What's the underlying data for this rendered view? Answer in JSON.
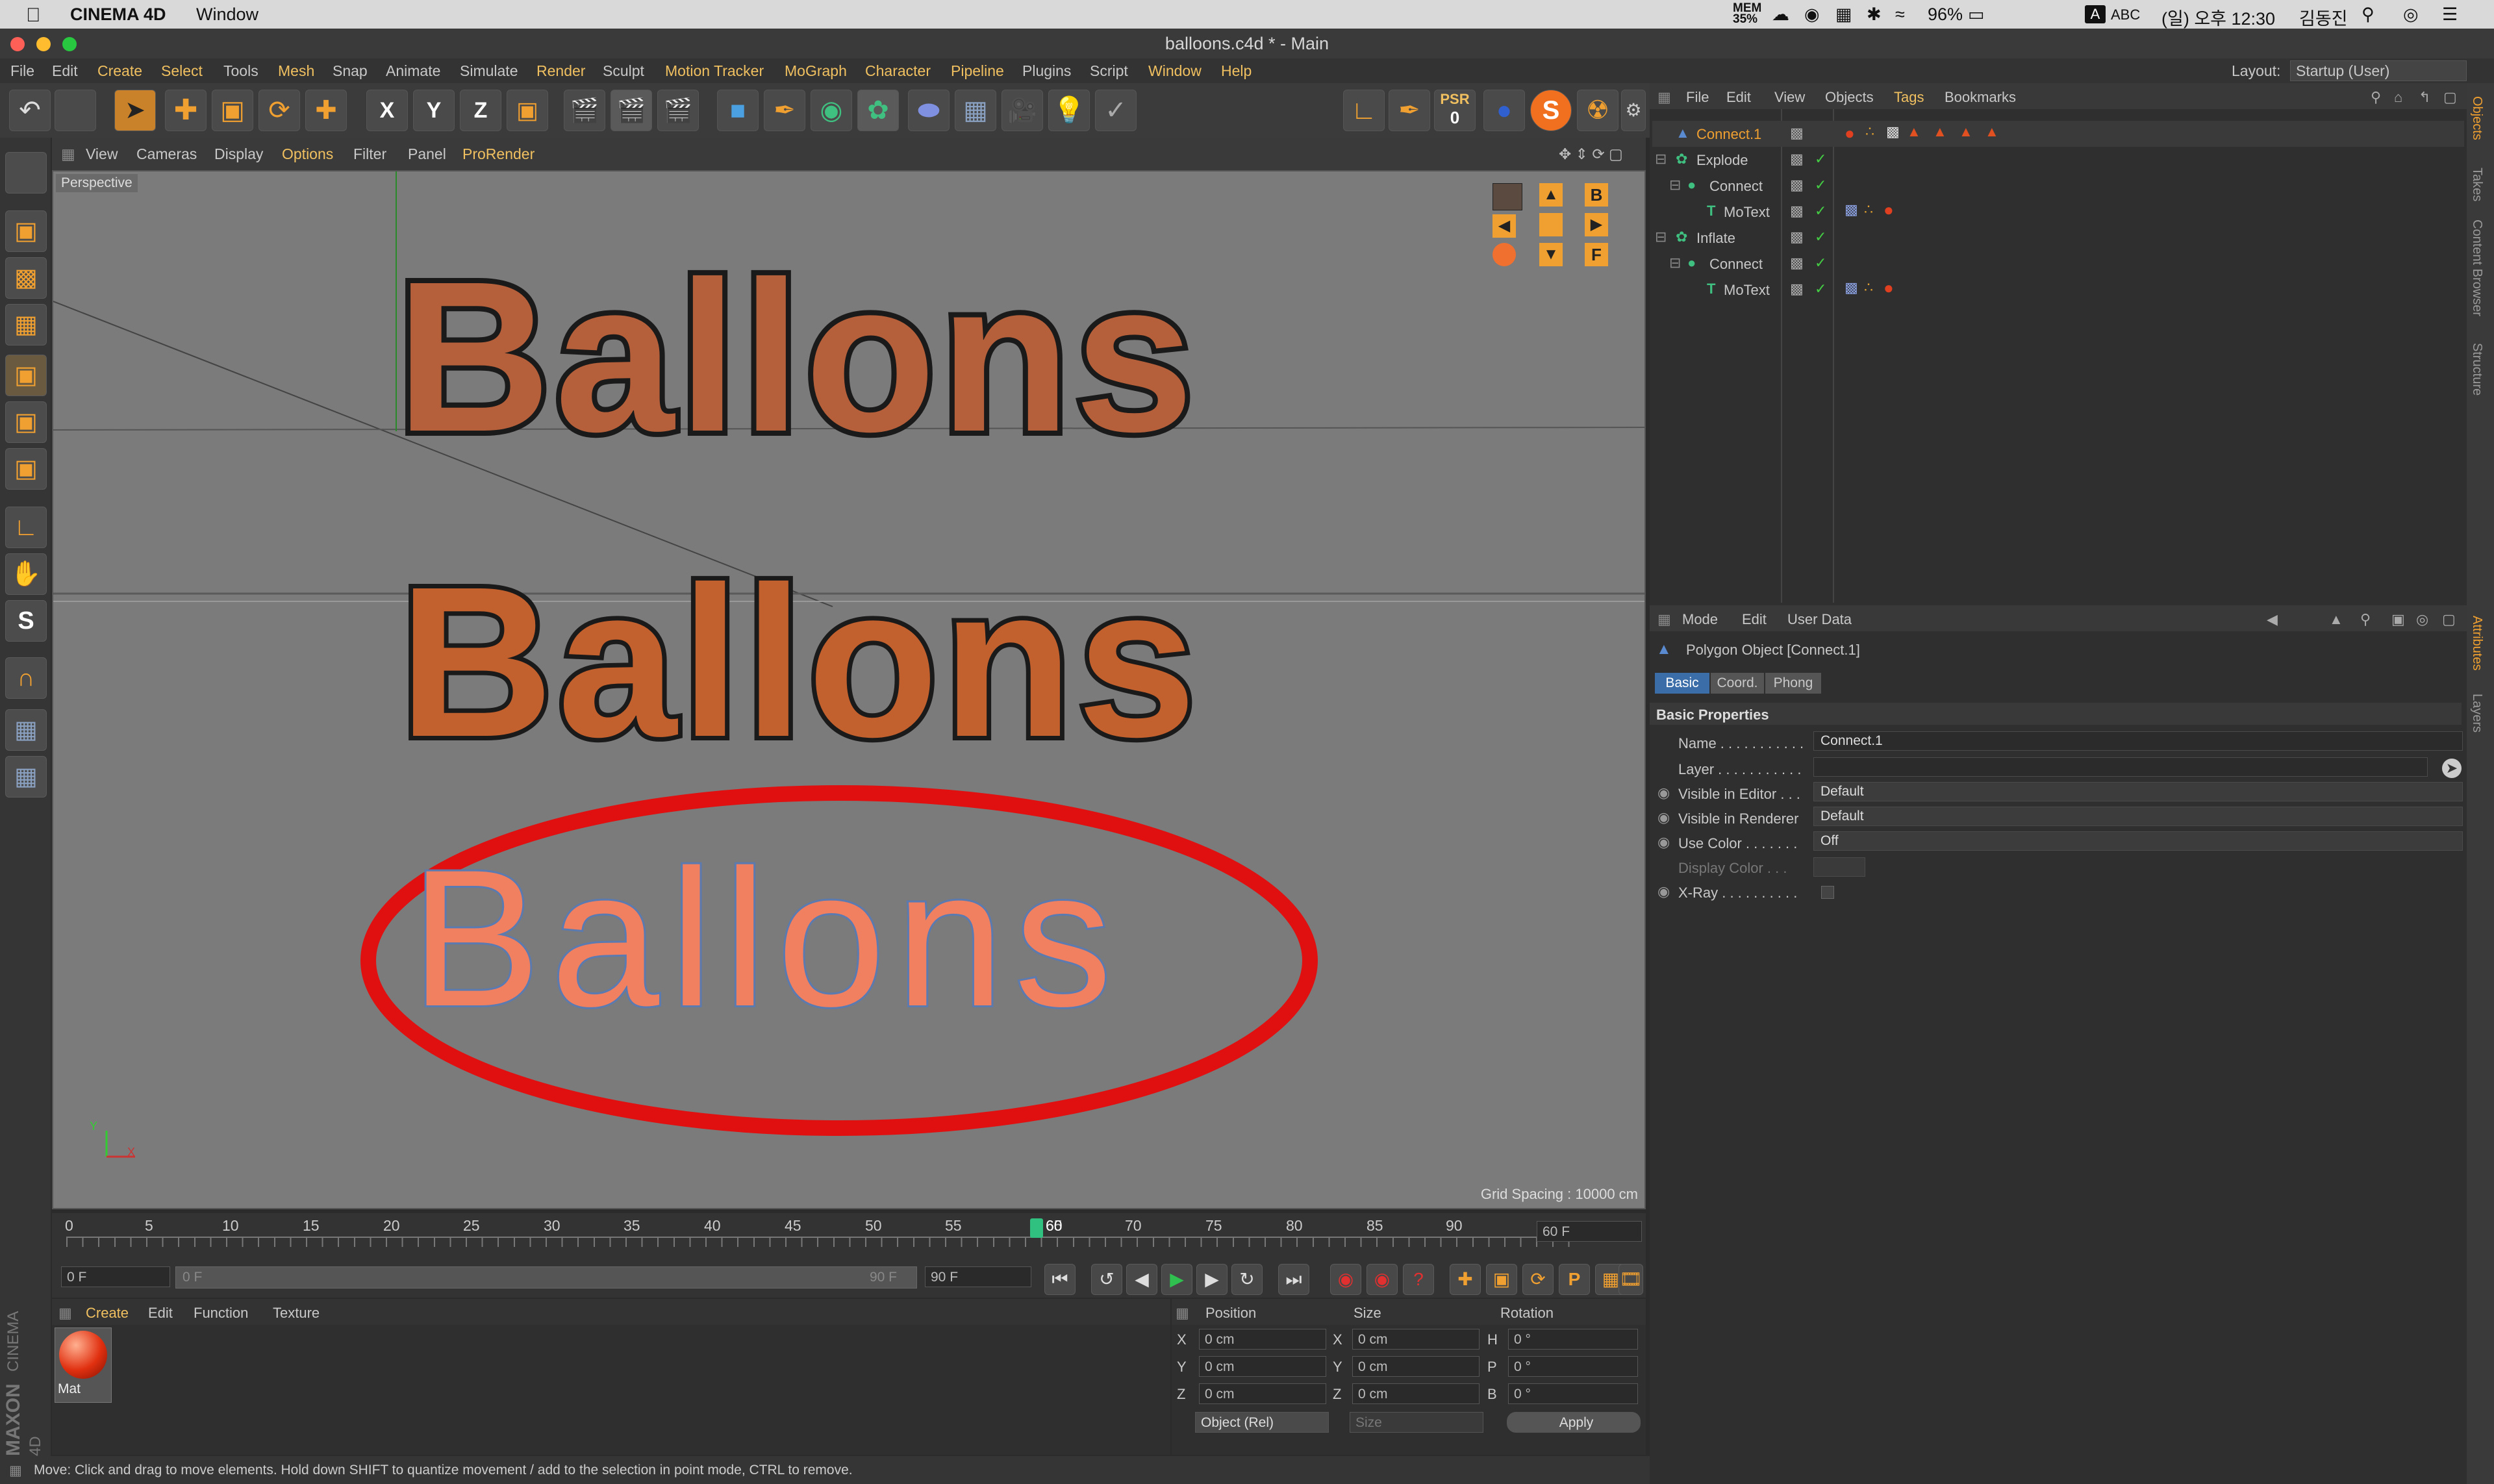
{
  "system_bar": {
    "app": "CINEMA 4D",
    "window": "Window",
    "mem": "MEM 35%",
    "battery": "96%",
    "input_method": "ABC",
    "clock": "(일) 오후 12:30",
    "user": "김동진"
  },
  "window": {
    "title": "balloons.c4d * - Main"
  },
  "menu": {
    "items": [
      "File",
      "Edit",
      "Create",
      "Select",
      "Tools",
      "Mesh",
      "Snap",
      "Animate",
      "Simulate",
      "Render",
      "Sculpt",
      "Motion Tracker",
      "MoGraph",
      "Character",
      "Pipeline",
      "Plugins",
      "Script",
      "Window",
      "Help"
    ],
    "layout_label": "Layout:",
    "layout_value": "Startup (User)"
  },
  "toolbar": {
    "x": "X",
    "y": "Y",
    "z": "Z",
    "psr_label": "PSR",
    "psr_value": "0"
  },
  "viewport_menu": {
    "items": [
      "View",
      "Cameras",
      "Display",
      "Options",
      "Filter",
      "Panel",
      "ProRender"
    ]
  },
  "viewport": {
    "label": "Perspective",
    "grid_spacing": "Grid Spacing : 10000 cm",
    "text_top": "Ballons",
    "text_mid": "Ballons",
    "text_bottom": "Ballons",
    "axis_y": "Y",
    "axis_x": "X",
    "nav_letters": [
      "B",
      "F"
    ]
  },
  "timeline": {
    "ticks": [
      "0",
      "5",
      "10",
      "15",
      "20",
      "25",
      "30",
      "35",
      "40",
      "45",
      "50",
      "55",
      "60",
      "65",
      "70",
      "75",
      "80",
      "85",
      "90"
    ],
    "current": "60",
    "end_field": "60 F"
  },
  "playbar": {
    "start_field": "0 F",
    "range_start": "0 F",
    "range_end": "90 F",
    "end_field": "90 F"
  },
  "materials": {
    "menu": [
      "Create",
      "Edit",
      "Function",
      "Texture"
    ],
    "items": [
      {
        "name": "Mat"
      }
    ]
  },
  "coordinates": {
    "headers": [
      "Position",
      "Size",
      "Rotation"
    ],
    "rows": [
      {
        "axis": "X",
        "pos": "0 cm",
        "size_axis": "X",
        "size": "0 cm",
        "rot_axis": "H",
        "rot": "0 °"
      },
      {
        "axis": "Y",
        "pos": "0 cm",
        "size_axis": "Y",
        "size": "0 cm",
        "rot_axis": "P",
        "rot": "0 °"
      },
      {
        "axis": "Z",
        "pos": "0 cm",
        "size_axis": "Z",
        "size": "0 cm",
        "rot_axis": "B",
        "rot": "0 °"
      }
    ],
    "mode": "Object (Rel)",
    "size_mode": "Size",
    "apply": "Apply"
  },
  "status": {
    "text": "Move: Click and drag to move elements. Hold down SHIFT to quantize movement / add to the selection in point mode, CTRL to remove."
  },
  "branding": {
    "maxon": "MAXON",
    "product": "CINEMA 4D"
  },
  "objects_panel": {
    "menu": [
      "File",
      "Edit",
      "View",
      "Objects",
      "Tags",
      "Bookmarks"
    ],
    "rows": [
      {
        "name": "Connect.1",
        "indent": 0,
        "selected": true
      },
      {
        "name": "Explode",
        "indent": 0
      },
      {
        "name": "Connect",
        "indent": 1
      },
      {
        "name": "MoText",
        "indent": 2
      },
      {
        "name": "Inflate",
        "indent": 0
      },
      {
        "name": "Connect",
        "indent": 1
      },
      {
        "name": "MoText",
        "indent": 2
      }
    ]
  },
  "attributes_panel": {
    "menu": [
      "Mode",
      "Edit",
      "User Data"
    ],
    "object_title": "Polygon Object [Connect.1]",
    "tabs": [
      "Basic",
      "Coord.",
      "Phong"
    ],
    "section": "Basic Properties",
    "fields": {
      "name_label": "Name . . . . . . . . . . .",
      "name_value": "Connect.1",
      "layer_label": "Layer . . . . . . . . . . .",
      "vis_editor_label": "Visible in Editor . . .",
      "vis_editor_value": "Default",
      "vis_renderer_label": "Visible in Renderer",
      "vis_renderer_value": "Default",
      "use_color_label": "Use Color . . . . . . .",
      "use_color_value": "Off",
      "display_color_label": "Display Color . . .",
      "xray_label": "X-Ray . . . . . . . . . ."
    }
  },
  "side_tabs": [
    "Objects",
    "Takes",
    "Content Browser",
    "Structure",
    "Attributes",
    "Layers"
  ],
  "colors": {
    "accent": "#f0a030",
    "highlight_red": "#e01010",
    "text_orange": "#c85a2a"
  }
}
